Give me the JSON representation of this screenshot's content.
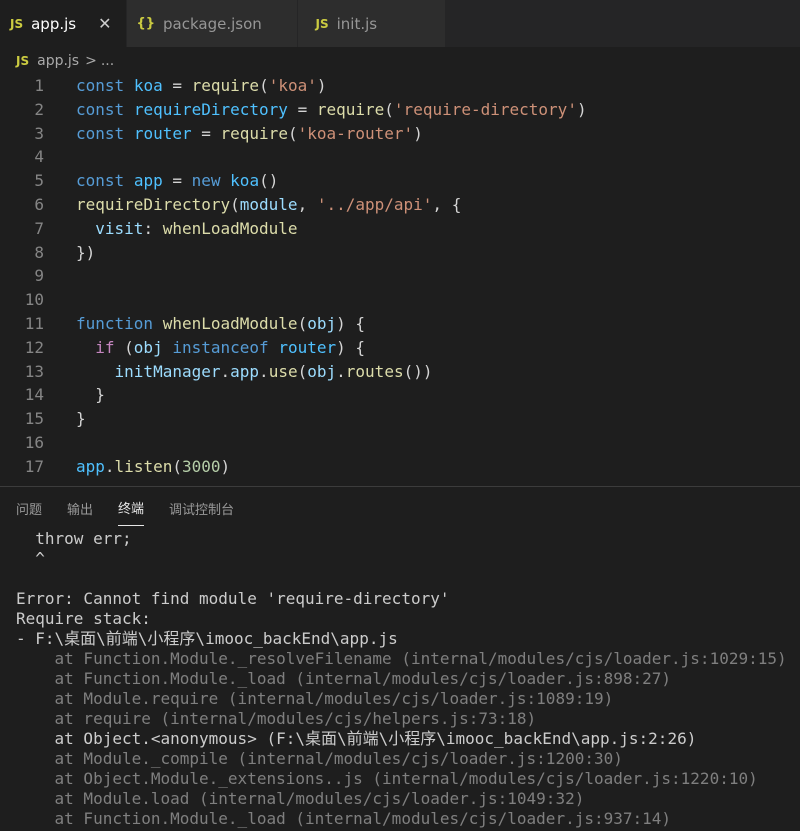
{
  "tabs": [
    {
      "icon": "JS",
      "label": "app.js",
      "close": "✕"
    },
    {
      "icon": "{}",
      "label": "package.json"
    },
    {
      "icon": "JS",
      "label": "init.js"
    }
  ],
  "breadcrumb": {
    "icon": "JS",
    "file": "app.js",
    "sep": ">",
    "more": "..."
  },
  "editor": {
    "line_numbers": [
      "1",
      "2",
      "3",
      "4",
      "5",
      "6",
      "7",
      "8",
      "9",
      "10",
      "11",
      "12",
      "13",
      "14",
      "15",
      "16",
      "17"
    ],
    "tokens": {
      "l1": [
        "const",
        " ",
        "koa",
        " = ",
        "require",
        "(",
        "'koa'",
        ")"
      ],
      "l2": [
        "const",
        " ",
        "requireDirectory",
        " = ",
        "require",
        "(",
        "'require-directory'",
        ")"
      ],
      "l3": [
        "const",
        " ",
        "router",
        " = ",
        "require",
        "(",
        "'koa-router'",
        ")"
      ],
      "l5": [
        "const",
        " ",
        "app",
        " = ",
        "new",
        " ",
        "koa",
        "()"
      ],
      "l6": [
        "requireDirectory",
        "(",
        "module",
        ", ",
        "'../app/api'",
        ", {"
      ],
      "l7": [
        "  ",
        "visit",
        ": ",
        "whenLoadModule"
      ],
      "l8": [
        "})"
      ],
      "l11": [
        "function",
        " ",
        "whenLoadModule",
        "(",
        "obj",
        ") {"
      ],
      "l12": [
        "  ",
        "if",
        " (",
        "obj",
        " ",
        "instanceof",
        " ",
        "router",
        ") {"
      ],
      "l13": [
        "    ",
        "initManager",
        ".",
        "app",
        ".",
        "use",
        "(",
        "obj",
        ".",
        "routes",
        "())"
      ],
      "l14": [
        "  }"
      ],
      "l15": [
        "}"
      ],
      "l17": [
        "app",
        ".",
        "listen",
        "(",
        "3000",
        ")"
      ]
    }
  },
  "panel": {
    "tabs": [
      "问题",
      "输出",
      "终端",
      "调试控制台"
    ],
    "active_tab": "终端",
    "terminal_lines": [
      "  throw err;",
      "  ^",
      "",
      "Error: Cannot find module 'require-directory'",
      "Require stack:",
      "- F:\\桌面\\前端\\小程序\\imooc_backEnd\\app.js",
      "    at Function.Module._resolveFilename (internal/modules/cjs/loader.js:1029:15)",
      "    at Function.Module._load (internal/modules/cjs/loader.js:898:27)",
      "    at Module.require (internal/modules/cjs/loader.js:1089:19)",
      "    at require (internal/modules/cjs/helpers.js:73:18)",
      "    at Object.<anonymous> (F:\\桌面\\前端\\小程序\\imooc_backEnd\\app.js:2:26)",
      "    at Module._compile (internal/modules/cjs/loader.js:1200:30)",
      "    at Object.Module._extensions..js (internal/modules/cjs/loader.js:1220:10)",
      "    at Module.load (internal/modules/cjs/loader.js:1049:32)",
      "    at Function.Module._load (internal/modules/cjs/loader.js:937:14)"
    ]
  },
  "colors": {
    "background": "#1e1e1e",
    "keyword": "#569cd6",
    "string": "#ce9178",
    "function": "#dcdcaa",
    "variable": "#4fc1ff"
  }
}
